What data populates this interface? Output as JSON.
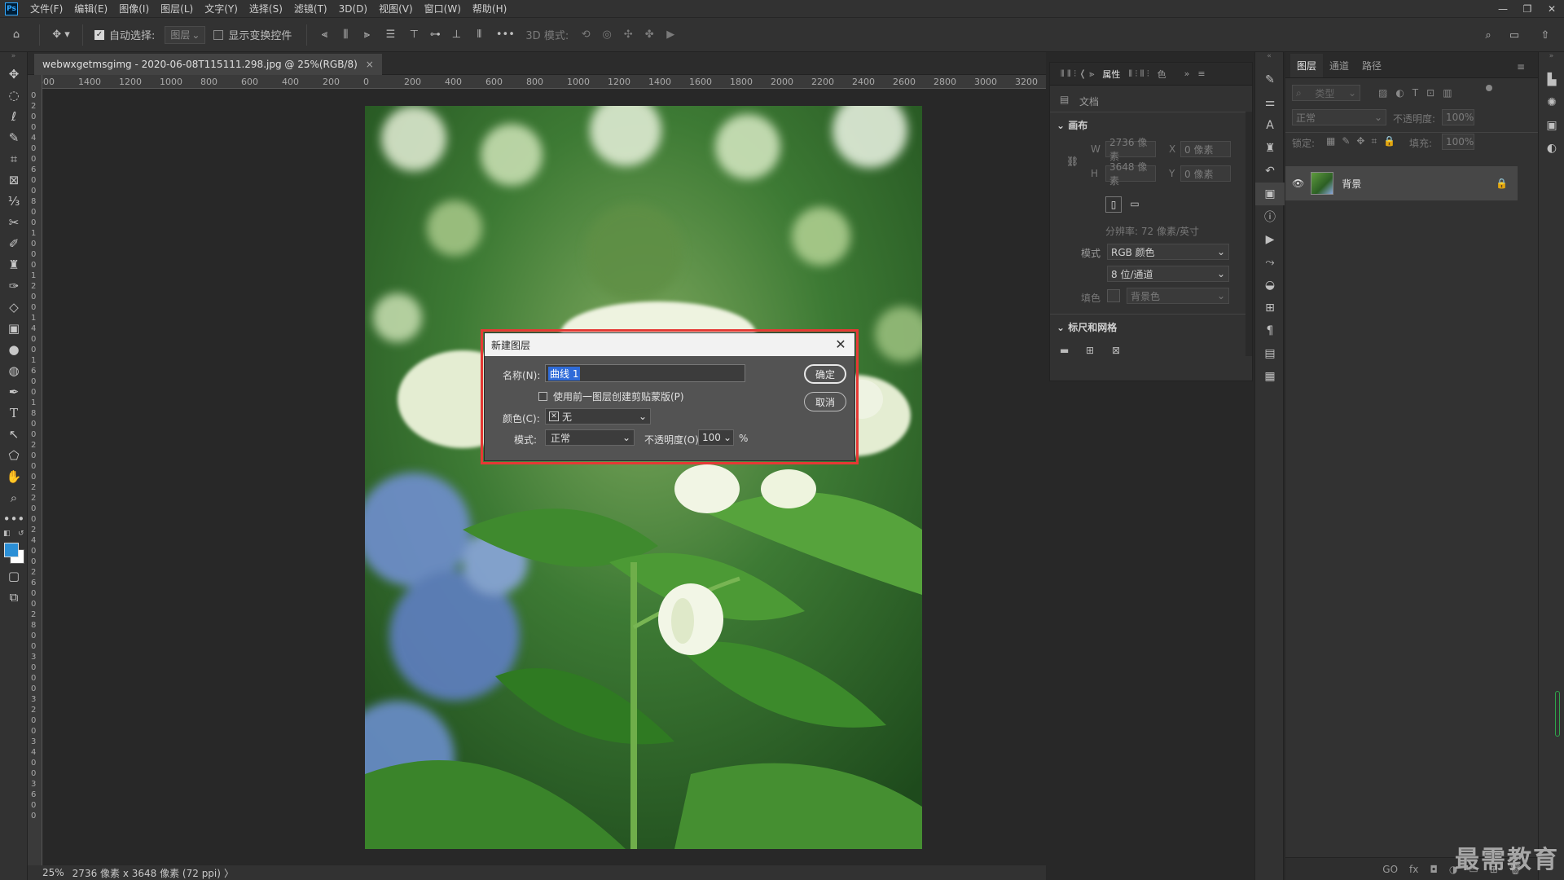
{
  "app": {
    "logo": "Ps",
    "window_controls": [
      "—",
      "❐",
      "✕"
    ]
  },
  "menu": [
    "文件(F)",
    "编辑(E)",
    "图像(I)",
    "图层(L)",
    "文字(Y)",
    "选择(S)",
    "滤镜(T)",
    "3D(D)",
    "视图(V)",
    "窗口(W)",
    "帮助(H)"
  ],
  "options": {
    "auto_select_label": "自动选择:",
    "auto_select_checked": true,
    "auto_select_target": "图层",
    "show_transform_label": "显示变换控件",
    "show_transform_checked": false,
    "more": "•••",
    "mode_3d_label": "3D 模式:"
  },
  "document": {
    "tab_title": "webwxgetmsgimg - 2020-06-08T115111.298.jpg @ 25%(RGB/8)",
    "tab_close": "×",
    "zoom": "25%",
    "status_info": "2736 像素 x 3648 像素 (72 ppi)",
    "status_arrow": "〉"
  },
  "ruler": {
    "h_labels": [
      "600",
      "1400",
      "1200",
      "1000",
      "800",
      "600",
      "400",
      "200",
      "0",
      "200",
      "400",
      "600",
      "800",
      "1000",
      "1200",
      "1400",
      "1600",
      "1800",
      "2000",
      "2200",
      "2400",
      "2600",
      "2800",
      "3000",
      "3200"
    ],
    "v_labels": [
      "0",
      "2",
      "0",
      "0",
      "4",
      "0",
      "0",
      "6",
      "0",
      "0",
      "8",
      "0",
      "0",
      "1",
      "0",
      "0",
      "0",
      "1",
      "2",
      "0",
      "0",
      "1",
      "4",
      "0",
      "0",
      "1",
      "6",
      "0",
      "0",
      "1",
      "8",
      "0",
      "0",
      "2",
      "0",
      "0",
      "0",
      "2",
      "2",
      "0",
      "0",
      "2",
      "4",
      "0",
      "0",
      "2",
      "6",
      "0",
      "0",
      "2",
      "8",
      "0",
      "0",
      "3",
      "0",
      "0",
      "0",
      "3",
      "2",
      "0",
      "0",
      "3",
      "4",
      "0",
      "0",
      "3",
      "6",
      "0",
      "0"
    ]
  },
  "properties": {
    "tabs": [
      "属性",
      "色"
    ],
    "section_doc": "文档",
    "section_canvas": "画布",
    "w_label": "W",
    "w_value": "2736 像素",
    "h_label": "H",
    "h_value": "3648 像素",
    "x_label": "X",
    "x_value": "0 像素",
    "y_label": "Y",
    "y_value": "0 像素",
    "resolution": "分辨率: 72 像素/英寸",
    "mode_label": "模式",
    "mode_value": "RGB 颜色",
    "depth_value": "8 位/通道",
    "fill_label": "填色",
    "fill_value": "背景色",
    "section_rulers": "标尺和网格"
  },
  "layers": {
    "tabs": [
      "图层",
      "通道",
      "路径"
    ],
    "search_placeholder": "类型",
    "blend_mode": "正常",
    "opacity_label": "不透明度:",
    "opacity_value": "100%",
    "lock_label": "锁定:",
    "fill_label": "填充:",
    "fill_value": "100%",
    "layer_name": "背景",
    "bottom_icons": [
      "GO",
      "fx",
      "◘",
      "◑",
      "▭",
      "⊞",
      "🗑"
    ]
  },
  "dialog": {
    "title": "新建图层",
    "name_label": "名称(N):",
    "name_value": "曲线 1",
    "clip_label": "使用前一图层创建剪贴蒙版(P)",
    "clip_checked": false,
    "color_label": "颜色(C):",
    "color_value": "无",
    "mode_label": "模式:",
    "mode_value": "正常",
    "opacity_label": "不透明度(O):",
    "opacity_value": "100",
    "opacity_unit": "%",
    "ok_label": "确定",
    "cancel_label": "取消"
  },
  "watermark": "最需教育",
  "colors": {
    "foreground": "#2b8fd6",
    "background": "#ffffff",
    "highlight": "#e53935",
    "selection": "#2f6bd8"
  }
}
